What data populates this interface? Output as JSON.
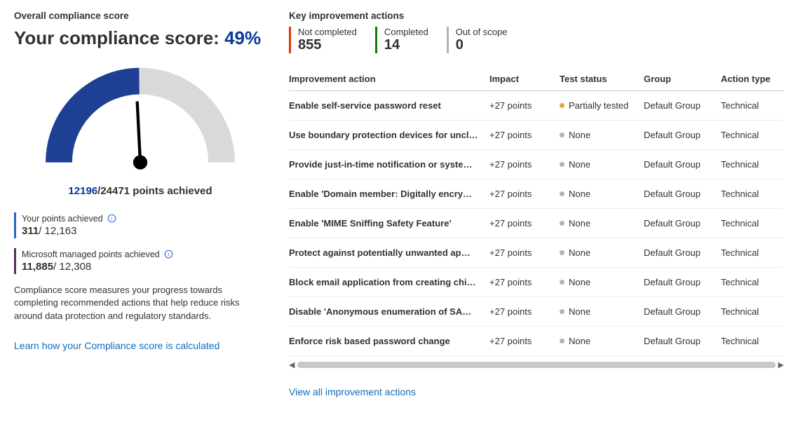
{
  "chart_data": {
    "type": "gauge",
    "value": 12196,
    "max": 24471,
    "percent": 49,
    "title": "Your compliance score"
  },
  "left": {
    "heading": "Overall compliance score",
    "title_prefix": "Your compliance score: ",
    "percent": "49%",
    "points_achieved_num": "12196",
    "points_achieved_sep": "/",
    "points_achieved_den": "24471 points achieved",
    "yours_label": "Your points achieved",
    "yours_num": "311",
    "yours_of": "/ 12,163",
    "ms_label": "Microsoft managed points achieved",
    "ms_num": "11,885",
    "ms_of": "/ 12,308",
    "desc": "Compliance score measures your progress towards completing recommended actions that help reduce risks around data protection and regulatory standards.",
    "learn_link": "Learn how your Compliance score is calculated"
  },
  "right": {
    "heading": "Key improvement actions",
    "counters": {
      "nc_label": "Not completed",
      "nc_value": "855",
      "c_label": "Completed",
      "c_value": "14",
      "os_label": "Out of scope",
      "os_value": "0"
    },
    "columns": {
      "action": "Improvement action",
      "impact": "Impact",
      "status": "Test status",
      "group": "Group",
      "type": "Action type"
    },
    "rows": [
      {
        "action": "Enable self-service password reset",
        "impact": "+27 points",
        "status": "Partially tested",
        "dot": "orange",
        "group": "Default Group",
        "type": "Technical"
      },
      {
        "action": "Use boundary protection devices for uncl…",
        "impact": "+27 points",
        "status": "None",
        "dot": "gray",
        "group": "Default Group",
        "type": "Technical"
      },
      {
        "action": "Provide just-in-time notification or syste…",
        "impact": "+27 points",
        "status": "None",
        "dot": "gray",
        "group": "Default Group",
        "type": "Technical"
      },
      {
        "action": "Enable 'Domain member: Digitally encry…",
        "impact": "+27 points",
        "status": "None",
        "dot": "gray",
        "group": "Default Group",
        "type": "Technical"
      },
      {
        "action": "Enable 'MIME Sniffing Safety Feature'",
        "impact": "+27 points",
        "status": "None",
        "dot": "gray",
        "group": "Default Group",
        "type": "Technical"
      },
      {
        "action": "Protect against potentially unwanted ap…",
        "impact": "+27 points",
        "status": "None",
        "dot": "gray",
        "group": "Default Group",
        "type": "Technical"
      },
      {
        "action": "Block email application from creating chi…",
        "impact": "+27 points",
        "status": "None",
        "dot": "gray",
        "group": "Default Group",
        "type": "Technical"
      },
      {
        "action": "Disable 'Anonymous enumeration of SA…",
        "impact": "+27 points",
        "status": "None",
        "dot": "gray",
        "group": "Default Group",
        "type": "Technical"
      },
      {
        "action": "Enforce risk based password change",
        "impact": "+27 points",
        "status": "None",
        "dot": "gray",
        "group": "Default Group",
        "type": "Technical"
      }
    ],
    "view_all": "View all improvement actions"
  }
}
